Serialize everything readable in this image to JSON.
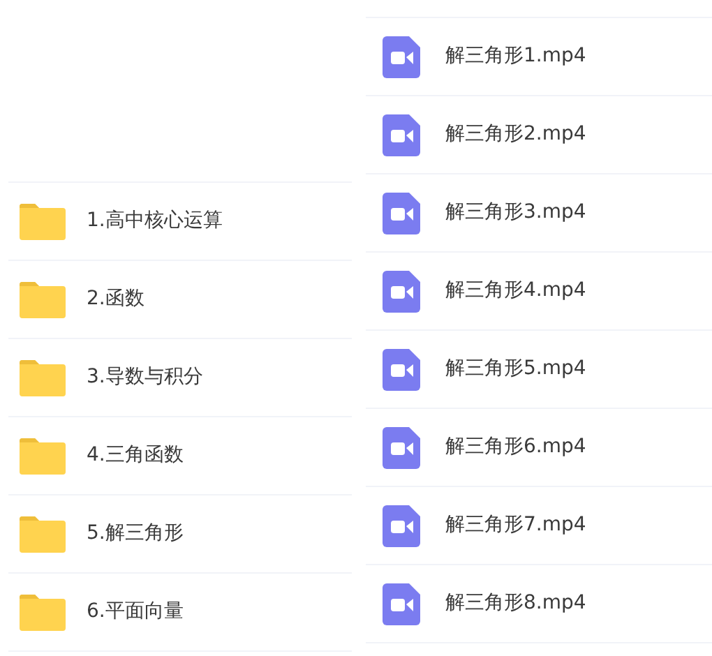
{
  "folders": [
    {
      "name": "1.高中核心运算"
    },
    {
      "name": "2.函数"
    },
    {
      "name": "3.导数与积分"
    },
    {
      "name": "4.三角函数"
    },
    {
      "name": "5.解三角形"
    },
    {
      "name": "6.平面向量"
    }
  ],
  "videos": [
    {
      "name": "解三角形1.mp4"
    },
    {
      "name": "解三角形2.mp4"
    },
    {
      "name": "解三角形3.mp4"
    },
    {
      "name": "解三角形4.mp4"
    },
    {
      "name": "解三角形5.mp4"
    },
    {
      "name": "解三角形6.mp4"
    },
    {
      "name": "解三角形7.mp4"
    },
    {
      "name": "解三角形8.mp4"
    }
  ]
}
